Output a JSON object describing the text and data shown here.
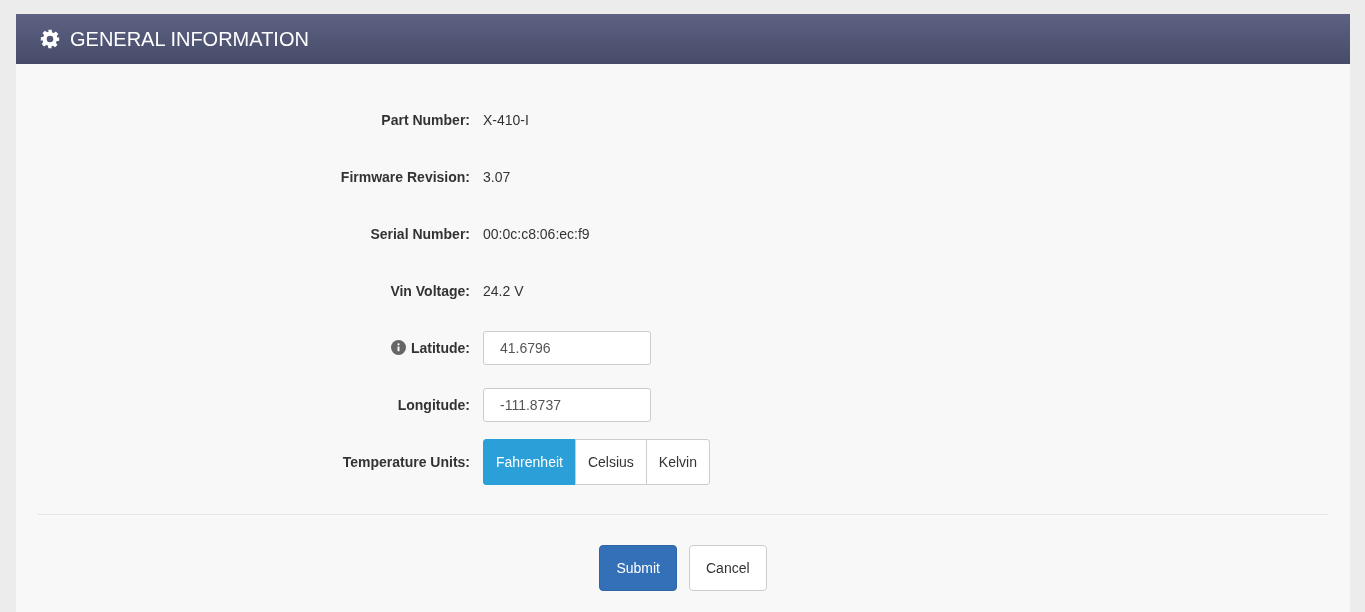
{
  "panel": {
    "title": "GENERAL INFORMATION"
  },
  "fields": [
    {
      "kind": "text",
      "label": "Part Number:",
      "value": "X-410-I"
    },
    {
      "kind": "text",
      "label": "Firmware Revision:",
      "value": "3.07"
    },
    {
      "kind": "text",
      "label": "Serial Number:",
      "value": "00:0c:c8:06:ec:f9"
    },
    {
      "kind": "text",
      "label": "Vin Voltage:",
      "value": "24.2 V"
    },
    {
      "kind": "input",
      "label": "Latitude:",
      "info": true,
      "value": "41.6796"
    },
    {
      "kind": "input",
      "label": "Longitude:",
      "info": false,
      "value": "-111.8737"
    },
    {
      "kind": "toggle",
      "label": "Temperature Units:",
      "options": [
        {
          "label": "Fahrenheit",
          "selected": true
        },
        {
          "label": "Celsius",
          "selected": false
        },
        {
          "label": "Kelvin",
          "selected": false
        }
      ]
    }
  ],
  "buttons": [
    {
      "kind": "primary",
      "label": "Submit"
    },
    {
      "kind": "default",
      "label": "Cancel"
    }
  ]
}
